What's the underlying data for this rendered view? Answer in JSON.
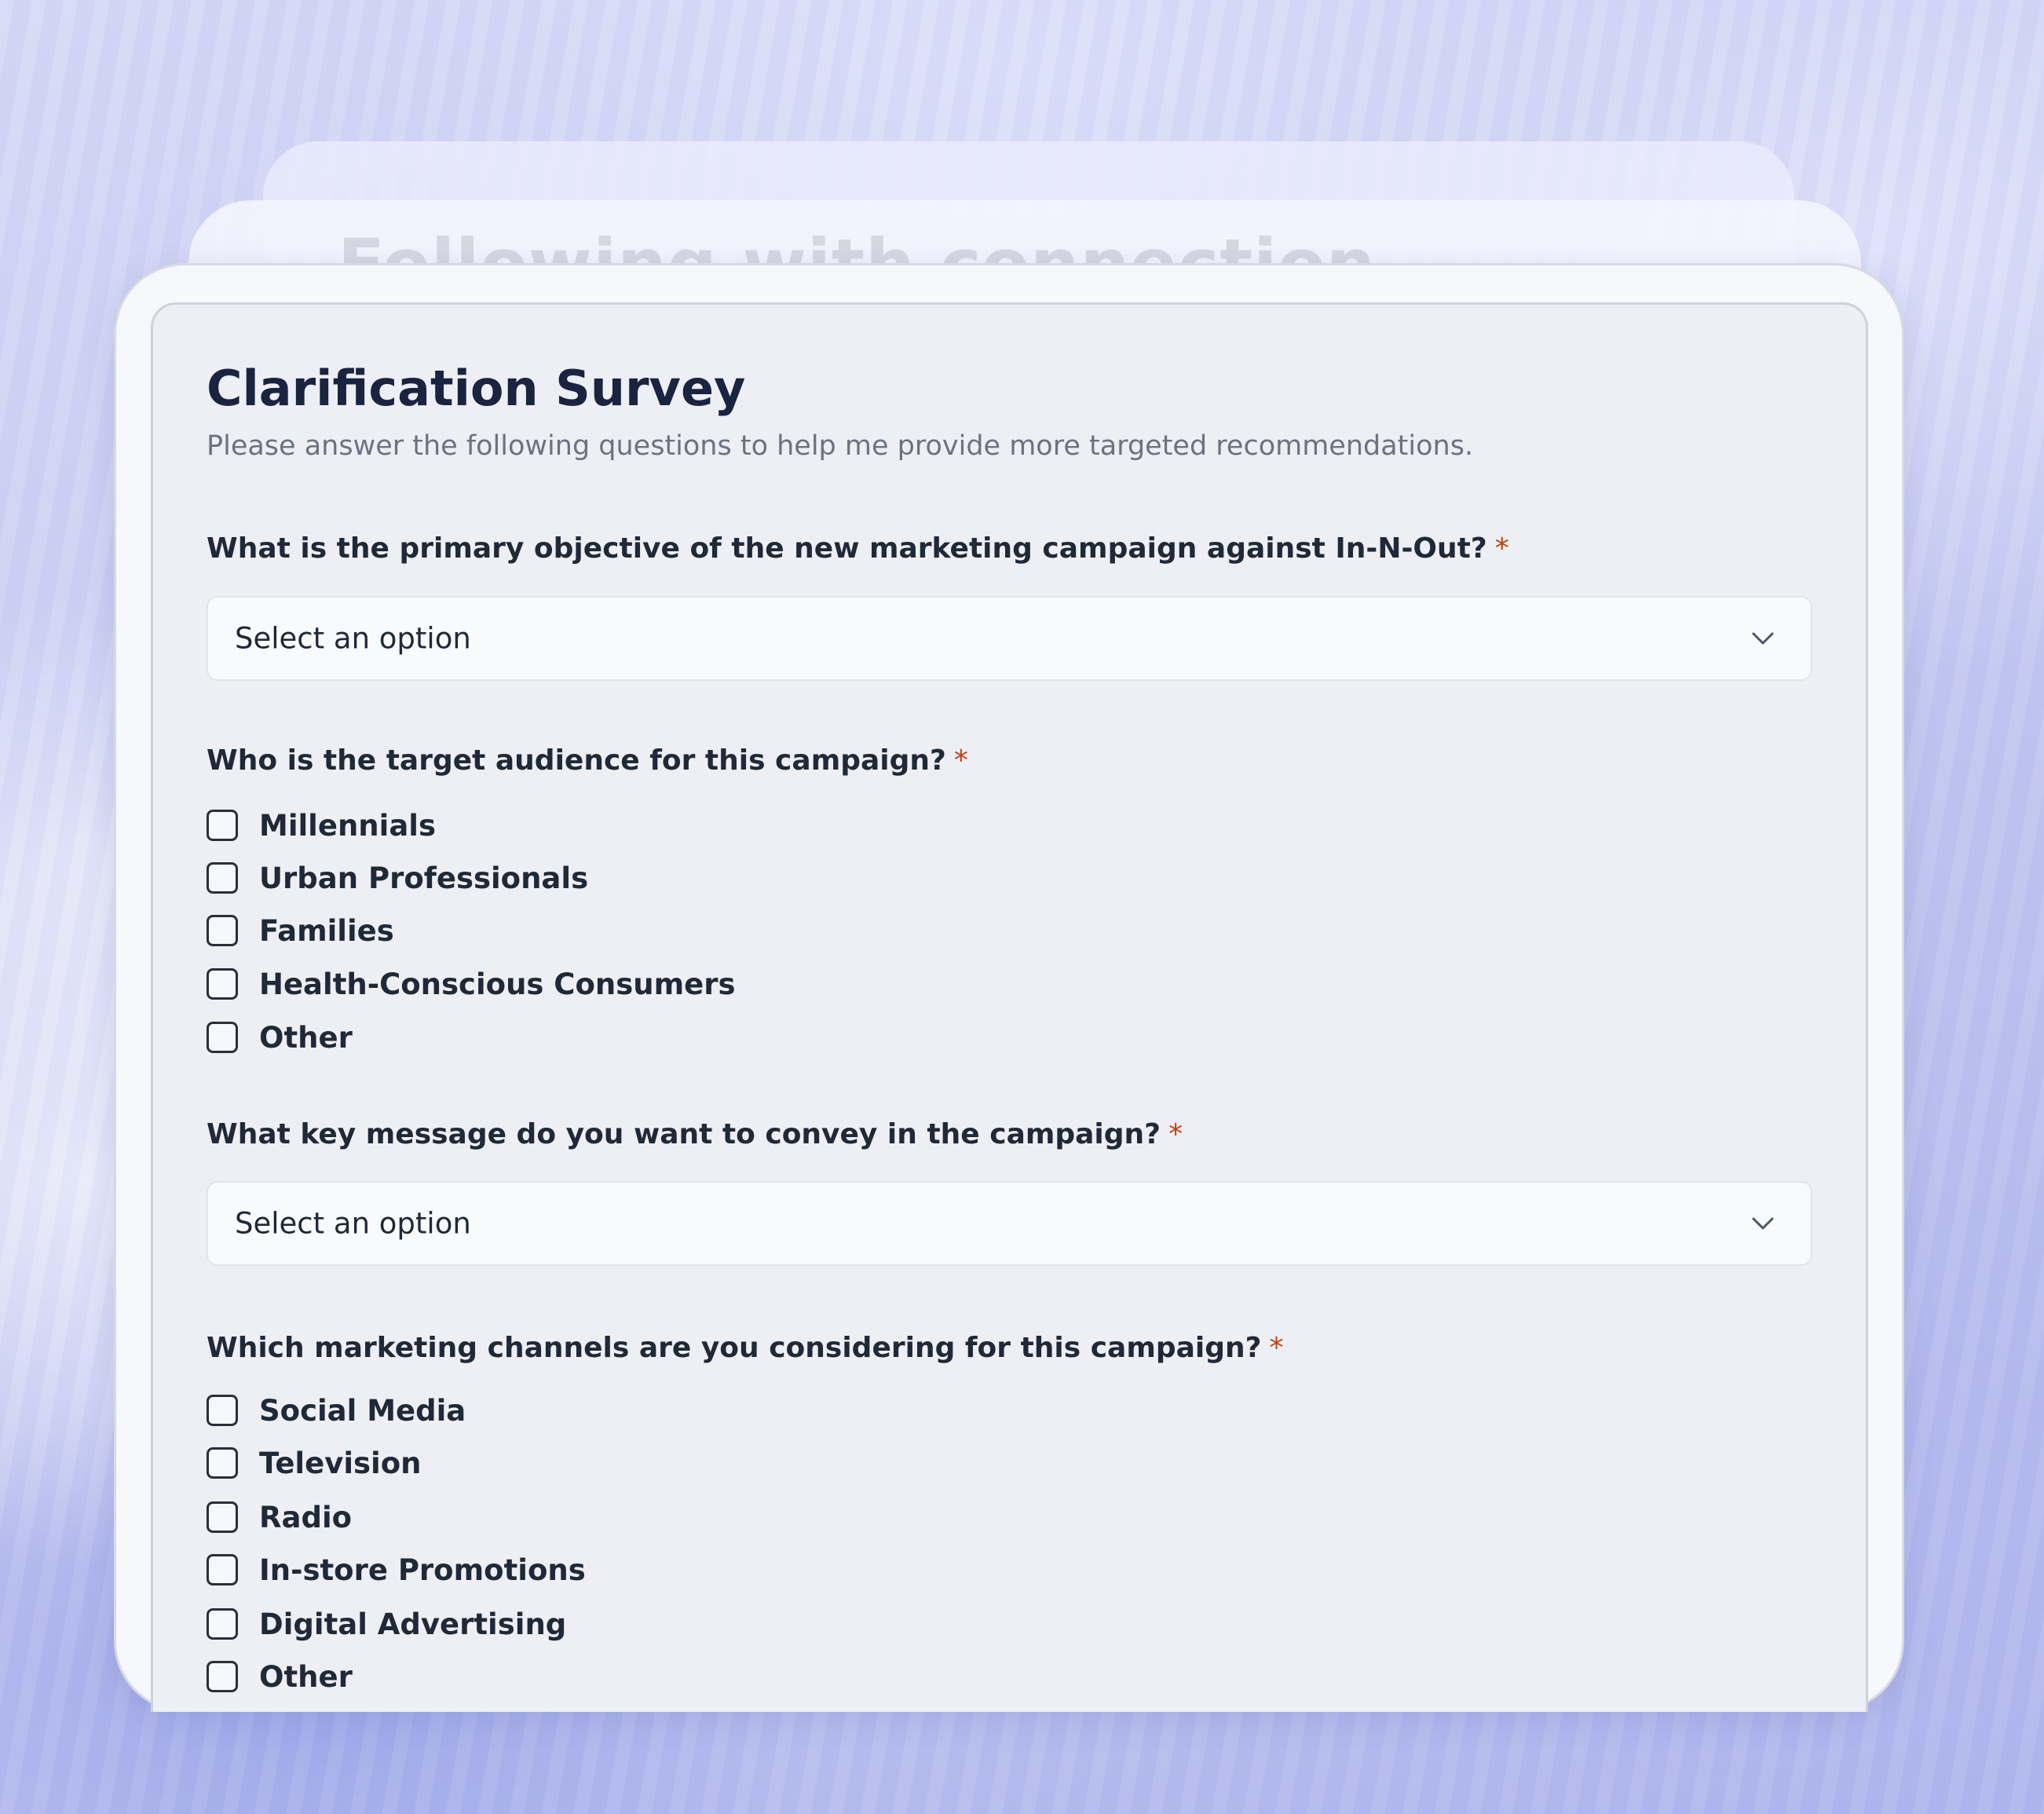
{
  "background": {
    "ghost_title": "Following with connection"
  },
  "survey": {
    "title": "Clarification Survey",
    "subtitle": "Please answer the following questions to help me provide more targeted recommendations."
  },
  "questions": {
    "q1": {
      "label": "What is the primary objective of the new marketing campaign against In-N-Out?",
      "required_mark": "*",
      "select_value": "Select an option"
    },
    "q2": {
      "label": "Who is the target audience for this campaign?",
      "required_mark": "*",
      "options": [
        "Millennials",
        "Urban Professionals",
        "Families",
        "Health-Conscious Consumers",
        "Other"
      ]
    },
    "q3": {
      "label": "What key message do you want to convey in the campaign?",
      "required_mark": "*",
      "select_value": "Select an option"
    },
    "q4": {
      "label": "Which marketing channels are you considering for this campaign?",
      "required_mark": "*",
      "options": [
        "Social Media",
        "Television",
        "Radio",
        "In-store Promotions",
        "Digital Advertising",
        "Other"
      ]
    }
  },
  "icons": {
    "dropdown": "chevron-down-icon",
    "checkbox": "checkbox-unchecked-icon"
  },
  "colors": {
    "required": "#c2410c",
    "title": "#1a2440",
    "subtitle": "#6b7280"
  }
}
